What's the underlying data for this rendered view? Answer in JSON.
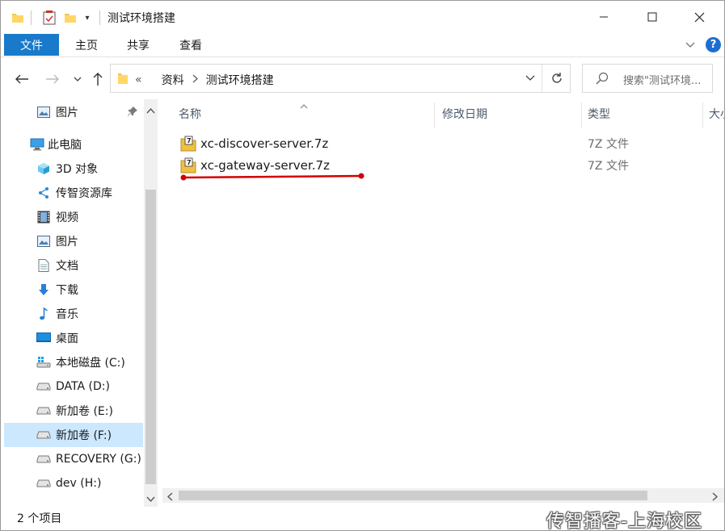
{
  "window": {
    "title": "测试环境搭建"
  },
  "ribbon": {
    "tabs": [
      {
        "label": "文件",
        "active": true
      },
      {
        "label": "主页"
      },
      {
        "label": "共享"
      },
      {
        "label": "查看"
      }
    ],
    "help_icon": "?"
  },
  "address": {
    "overflow": "«",
    "breadcrumbs": [
      "资料",
      "测试环境搭建"
    ]
  },
  "search": {
    "placeholder": "搜索\"测试环境..."
  },
  "navpane": {
    "items": [
      {
        "label": "图片",
        "icon": "pictures-icon",
        "pinned": true
      },
      {
        "label": "此电脑",
        "icon": "computer-icon"
      },
      {
        "label": "3D 对象",
        "icon": "3d-objects-icon"
      },
      {
        "label": "传智资源库",
        "icon": "share-network-icon"
      },
      {
        "label": "视频",
        "icon": "video-icon"
      },
      {
        "label": "图片",
        "icon": "pictures-icon"
      },
      {
        "label": "文档",
        "icon": "documents-icon"
      },
      {
        "label": "下载",
        "icon": "download-icon"
      },
      {
        "label": "音乐",
        "icon": "music-icon"
      },
      {
        "label": "桌面",
        "icon": "desktop-icon"
      },
      {
        "label": "本地磁盘 (C:)",
        "icon": "windows-drive-icon"
      },
      {
        "label": "DATA (D:)",
        "icon": "drive-icon"
      },
      {
        "label": "新加卷 (E:)",
        "icon": "drive-icon"
      },
      {
        "label": "新加卷 (F:)",
        "icon": "drive-icon",
        "selected": true
      },
      {
        "label": "RECOVERY (G:)",
        "icon": "drive-icon"
      },
      {
        "label": "dev (H:)",
        "icon": "drive-icon"
      }
    ]
  },
  "columns": {
    "name": "名称",
    "modified": "修改日期",
    "type": "类型",
    "size": "大小"
  },
  "files": [
    {
      "name": "xc-discover-server.7z",
      "type": "7Z 文件",
      "icon": "7z-archive-icon"
    },
    {
      "name": "xc-gateway-server.7z",
      "type": "7Z 文件",
      "icon": "7z-archive-icon"
    }
  ],
  "annotation": {
    "color": "#d40000"
  },
  "status": {
    "count": "2 个项目"
  },
  "watermark": {
    "text": "传智播客-上海校区"
  },
  "colors": {
    "file_tab": "#1979ca",
    "selection": "#cce8ff",
    "help": "#1c6fd1"
  }
}
